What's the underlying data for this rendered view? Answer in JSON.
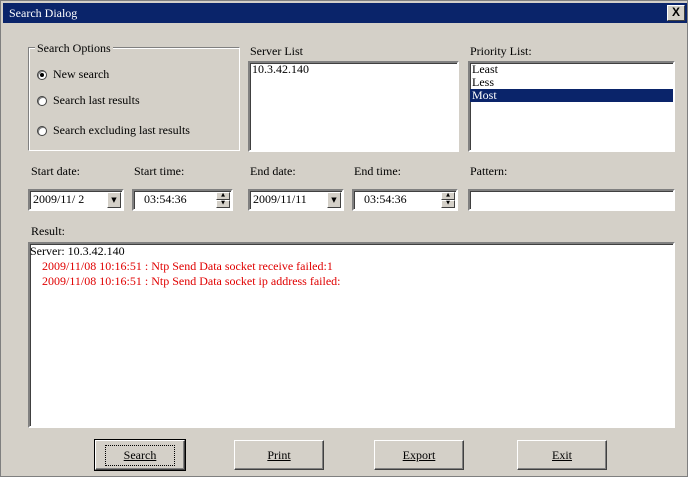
{
  "window": {
    "title": "Search Dialog",
    "close_label": "X"
  },
  "search_options": {
    "legend": "Search Options",
    "options": [
      {
        "label": "New search",
        "selected": true
      },
      {
        "label": "Search last results",
        "selected": false
      },
      {
        "label": "Search excluding last results",
        "selected": false
      }
    ]
  },
  "server_list": {
    "label": "Server List",
    "items": [
      "10.3.42.140"
    ]
  },
  "priority_list": {
    "label": "Priority List:",
    "items": [
      "Least",
      "Less",
      "Most"
    ],
    "selected": "Most"
  },
  "start_date": {
    "label": "Start date:",
    "value": "2009/11/ 2"
  },
  "start_time": {
    "label": "Start time:",
    "value": "03:54:36"
  },
  "end_date": {
    "label": "End date:",
    "value": "2009/11/11"
  },
  "end_time": {
    "label": "End time:",
    "value": "03:54:36"
  },
  "pattern": {
    "label": "Pattern:",
    "value": ""
  },
  "result": {
    "label": "Result:",
    "lines": [
      {
        "text": "Server: 10.3.42.140",
        "color": "#000000",
        "indent": false
      },
      {
        "text": "2009/11/08 10:16:51 : Ntp Send Data socket receive failed:1",
        "color": "#e00000",
        "indent": true
      },
      {
        "text": "2009/11/08 10:16:51 : Ntp Send Data socket ip address failed:",
        "color": "#e00000",
        "indent": true
      }
    ]
  },
  "buttons": {
    "search": "Search",
    "print": "Print",
    "export": "Export",
    "exit": "Exit"
  },
  "colors": {
    "title_bar": "#0a246a",
    "face": "#d4d0c8",
    "error_text": "#e00000",
    "selection": "#0a246a"
  }
}
